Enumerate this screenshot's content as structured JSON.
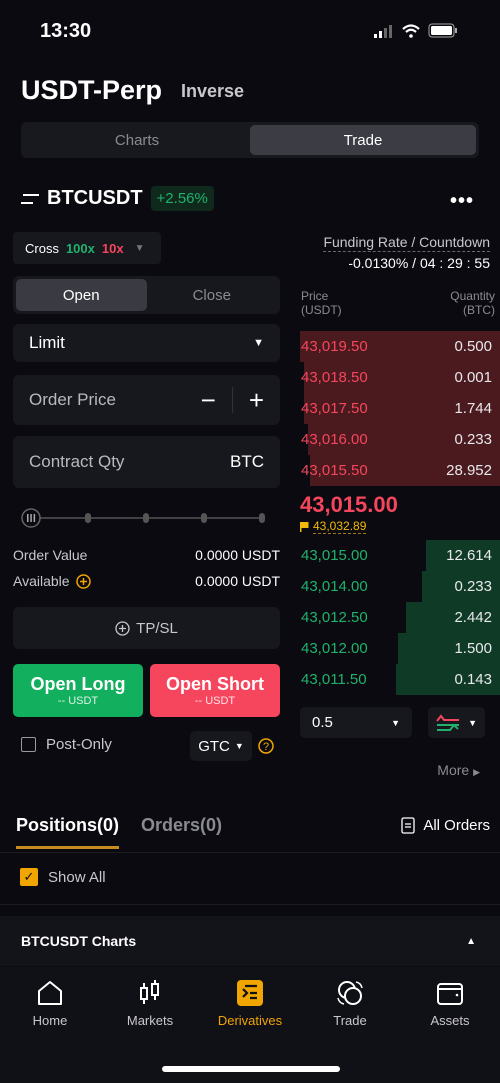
{
  "status_bar": {
    "time": "13:30"
  },
  "header": {
    "title": "USDT-Perp",
    "subtitle": "Inverse"
  },
  "view_tabs": [
    {
      "label": "Charts",
      "active": false
    },
    {
      "label": "Trade",
      "active": true
    }
  ],
  "pair": {
    "symbol": "BTCUSDT",
    "change": "+2.56%"
  },
  "margin": {
    "mode": "Cross",
    "long_leverage": "100x",
    "short_leverage": "10x"
  },
  "funding": {
    "label": "Funding Rate / Countdown",
    "value": "-0.0130% / 04 : 29 : 55"
  },
  "order_form": {
    "tabs": [
      {
        "label": "Open",
        "active": true
      },
      {
        "label": "Close",
        "active": false
      }
    ],
    "order_type": "Limit",
    "price_placeholder": "Order Price",
    "qty_placeholder": "Contract Qty",
    "qty_unit": "BTC",
    "slider_percent": 0,
    "order_value_label": "Order Value",
    "order_value": "0.0000 USDT",
    "available_label": "Available",
    "available_value": "0.0000 USDT",
    "tpsl_label": "TP/SL",
    "long_label": "Open Long",
    "long_sub": "-- USDT",
    "short_label": "Open Short",
    "short_sub": "-- USDT",
    "post_only_label": "Post-Only",
    "tif": "GTC"
  },
  "orderbook": {
    "price_header": "Price",
    "price_unit": "(USDT)",
    "qty_header": "Quantity",
    "qty_unit": "(BTC)",
    "asks": [
      {
        "price": "43,019.50",
        "qty": "0.500",
        "depth": 1.0
      },
      {
        "price": "43,018.50",
        "qty": "0.001",
        "depth": 0.98
      },
      {
        "price": "43,017.50",
        "qty": "1.744",
        "depth": 0.98
      },
      {
        "price": "43,016.00",
        "qty": "0.233",
        "depth": 0.96
      },
      {
        "price": "43,015.50",
        "qty": "28.952",
        "depth": 0.95
      }
    ],
    "last_price": "43,015.00",
    "mark_price": "43,032.89",
    "bids": [
      {
        "price": "43,015.00",
        "qty": "12.614",
        "depth": 0.37
      },
      {
        "price": "43,014.00",
        "qty": "0.233",
        "depth": 0.39
      },
      {
        "price": "43,012.50",
        "qty": "2.442",
        "depth": 0.47
      },
      {
        "price": "43,012.00",
        "qty": "1.500",
        "depth": 0.51
      },
      {
        "price": "43,011.50",
        "qty": "0.143",
        "depth": 0.52
      }
    ],
    "precision": "0.5",
    "more_label": "More"
  },
  "positions": {
    "tabs": [
      {
        "label": "Positions(0)",
        "active": true
      },
      {
        "label": "Orders(0)",
        "active": false
      }
    ],
    "all_orders_label": "All Orders",
    "show_all_label": "Show All",
    "charts_label": "BTCUSDT Charts"
  },
  "nav": [
    {
      "label": "Home",
      "icon": "home-icon",
      "active": false
    },
    {
      "label": "Markets",
      "icon": "candlestick-icon",
      "active": false
    },
    {
      "label": "Derivatives",
      "icon": "derivatives-icon",
      "active": true
    },
    {
      "label": "Trade",
      "icon": "trade-icon",
      "active": false
    },
    {
      "label": "Assets",
      "icon": "wallet-icon",
      "active": false
    }
  ],
  "colors": {
    "green": "#20b26c",
    "red": "#f6465d",
    "accent": "#f0a500",
    "ask_bg": "#4a1a1e",
    "bid_bg": "#0f3a26"
  }
}
